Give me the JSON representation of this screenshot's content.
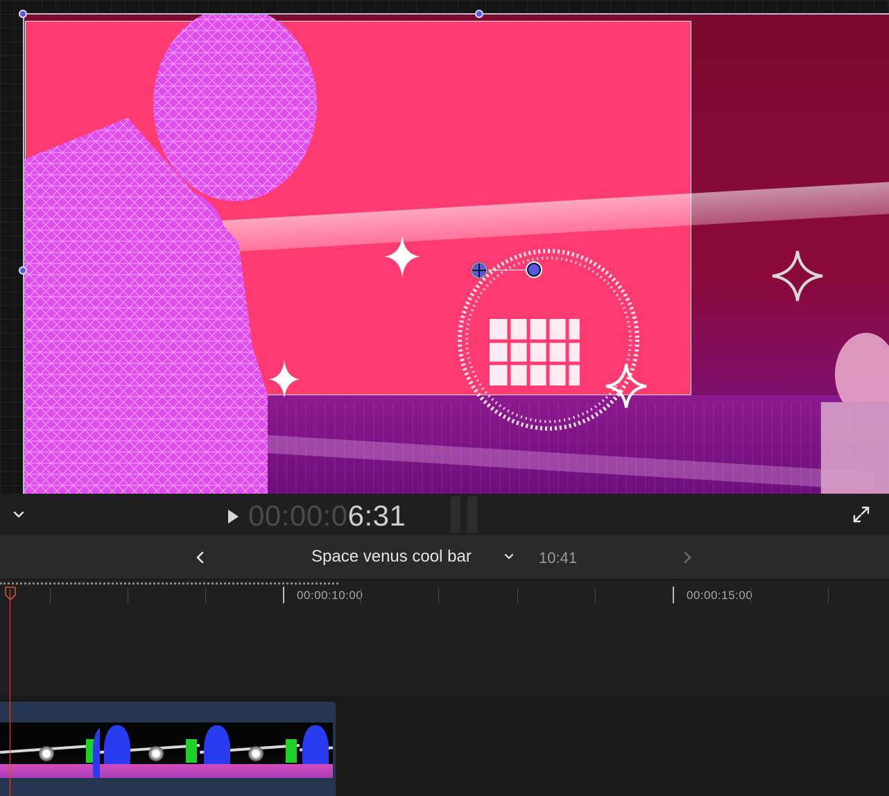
{
  "viewer": {
    "transport": {
      "timecode_dim": "00:00:0",
      "timecode_lit": "6:31"
    }
  },
  "timeline": {
    "project_name": "Space venus cool bar",
    "project_duration": "10:41",
    "ruler_labels": [
      "00:00:10:00",
      "00:00:15:00"
    ]
  },
  "icons": {
    "viewer_options": "chevron-down-icon",
    "play": "play-icon",
    "fullscreen": "fullscreen-icon",
    "back": "chevron-left-icon",
    "forward": "chevron-right-icon",
    "project_menu": "chevron-down-icon"
  },
  "colors": {
    "background_pink": "#ff3b72",
    "handle_blue": "#5a5ae0",
    "clip_blue": "#25344f",
    "playhead": "#c8553d"
  }
}
